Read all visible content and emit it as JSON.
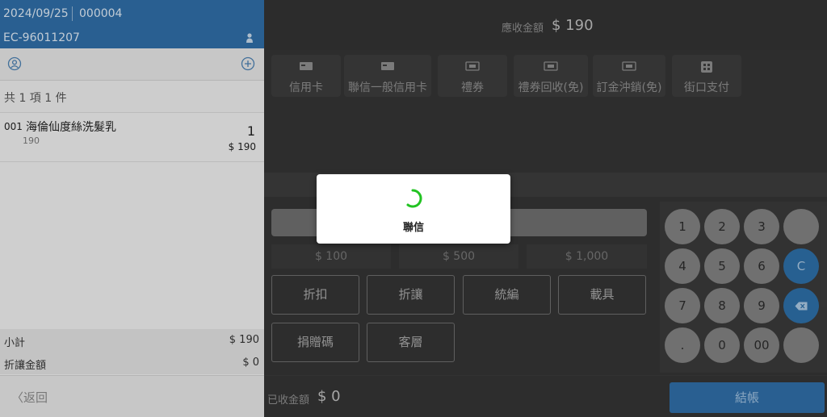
{
  "order": {
    "date": "2024/09/25",
    "number": "000004",
    "ec_code": "EC-96011207",
    "summary": "共 1 項 1 件",
    "items": [
      {
        "code": "001",
        "name": "海倫仙度絲洗髮乳",
        "price": "190",
        "qty": "1",
        "subtotal": "$ 190"
      }
    ],
    "subtotal_label": "小計",
    "subtotal_value": "$ 190",
    "discount_label": "折讓金額",
    "discount_value": "$ 0",
    "back_label": "返回"
  },
  "payment": {
    "due_label": "應收金額",
    "due_value": "$ 190",
    "methods": [
      {
        "label": "信用卡",
        "icon": "card-icon"
      },
      {
        "label": "聯信一般信用卡",
        "icon": "card-icon"
      },
      {
        "label": "禮券",
        "icon": "voucher-icon"
      },
      {
        "label": "禮券回收(免)",
        "icon": "voucher-icon"
      },
      {
        "label": "訂金沖銷(免)",
        "icon": "voucher-icon"
      },
      {
        "label": "街口支付",
        "icon": "qr-icon"
      }
    ],
    "quick_amounts": [
      "$ 100",
      "$ 500",
      "$ 1,000"
    ],
    "functions": [
      "折扣",
      "折讓",
      "統編",
      "載具",
      "捐贈碼",
      "客層"
    ],
    "keys": [
      "1",
      "2",
      "3",
      "",
      "4",
      "5",
      "6",
      "C",
      "7",
      "8",
      "9",
      "⌫",
      ".",
      "0",
      "00",
      ""
    ],
    "paid_label": "已收金額",
    "paid_value": "$ 0",
    "checkout_label": "結帳"
  },
  "dialog": {
    "text": "聯信"
  },
  "colors": {
    "accent": "#2f6da5",
    "spinner": "#22c322"
  }
}
